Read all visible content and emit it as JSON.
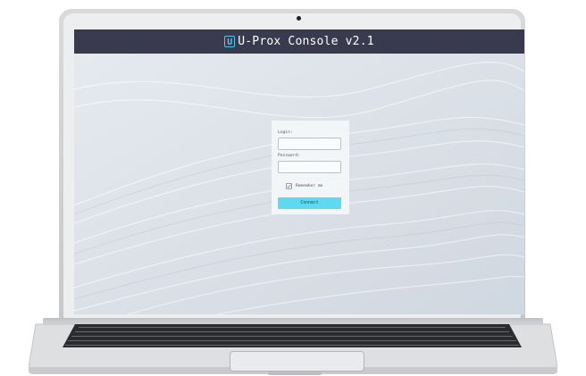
{
  "window": {
    "title": "U-Prox Console v2.1",
    "logo_letter": "U"
  },
  "login_form": {
    "login_label": "Login:",
    "login_value": "",
    "password_label": "Password:",
    "password_value": "",
    "remember_label": "Remember me",
    "remember_checked": true,
    "connect_label": "Connect"
  },
  "colors": {
    "titlebar": "#393a4d",
    "accent": "#5fd9ef",
    "logo": "#4cc7e8"
  }
}
